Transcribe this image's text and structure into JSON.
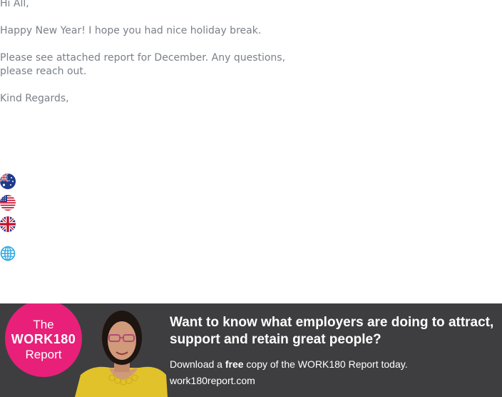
{
  "email": {
    "greeting": "Hi All,",
    "line1": "Happy New Year! I hope you had nice holiday break.",
    "line2": "Please see attached report for December. Any questions, please reach out.",
    "signoff": "Kind Regards,"
  },
  "flags": [
    {
      "name": "australia-flag-icon"
    },
    {
      "name": "usa-flag-icon"
    },
    {
      "name": "uk-flag-icon"
    },
    {
      "name": "globe-icon"
    }
  ],
  "banner": {
    "badge_line1": "The",
    "badge_line2": "WORK180",
    "badge_line3": "Report",
    "headline": "Want to know what employers are doing to attract, support and retain great people?",
    "sub_prefix": "Download a ",
    "sub_bold": "free",
    "sub_suffix": " copy of the WORK180 Report today.",
    "url": "work180report.com",
    "colors": {
      "badge": "#e8207a",
      "background": "#3e3e40",
      "accent_clothing": "#e2c22a"
    }
  }
}
